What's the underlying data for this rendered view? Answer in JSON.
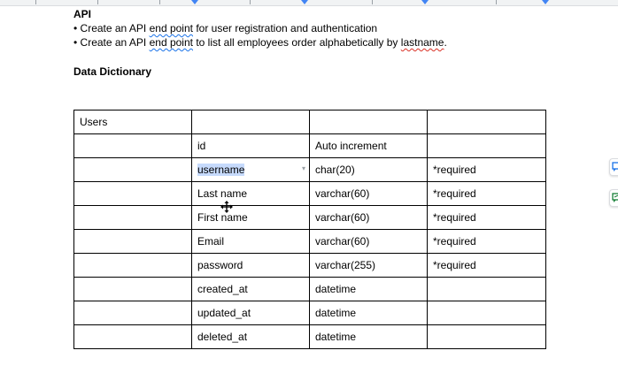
{
  "document": {
    "api_heading": "API",
    "bullets": [
      {
        "prefix": "• Create an API ",
        "term": "end point",
        "suffix": " for user registration and authentication"
      },
      {
        "prefix": "• Create an API ",
        "term": "end point",
        "suffix": " to list all employees order alphabetically by ",
        "term2": "lastname",
        "end": "."
      }
    ],
    "data_dictionary_heading": "Data Dictionary"
  },
  "table": {
    "rows": [
      [
        "Users",
        "",
        "",
        ""
      ],
      [
        "",
        "id",
        "Auto increment",
        ""
      ],
      [
        "",
        "username",
        "char(20)",
        "*required"
      ],
      [
        "",
        "Last name",
        "varchar(60)",
        "*required"
      ],
      [
        "",
        "First name",
        "varchar(60)",
        "*required"
      ],
      [
        "",
        "Email",
        "varchar(60)",
        "*required"
      ],
      [
        "",
        "password",
        "varchar(255)",
        "*required"
      ],
      [
        "",
        "created_at",
        "datetime",
        ""
      ],
      [
        "",
        "updated_at",
        "datetime",
        ""
      ],
      [
        "",
        "deleted_at",
        "datetime",
        ""
      ]
    ]
  },
  "colors": {
    "selection": "#c6dafc",
    "spellcheck": "#d93025",
    "grammar": "#1a73e8",
    "accent": "#4285f4"
  },
  "icons": {
    "cursor": "move-cursor-icon",
    "side_top": "comment-add-icon",
    "side_bottom": "suggest-edit-icon",
    "cell_menu": "chevron-down-icon"
  }
}
